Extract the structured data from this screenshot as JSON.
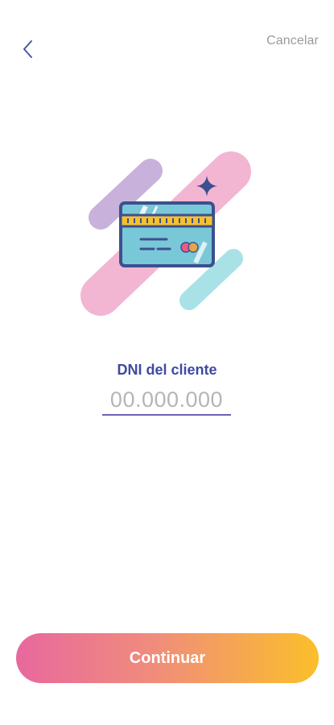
{
  "header": {
    "back_icon": "chevron-left-icon",
    "cancel_label": "Cancelar"
  },
  "illustration": {
    "icon": "credit-card-icon",
    "colors": {
      "pink": "#f2b6d2",
      "lavender": "#c8b2db",
      "teal": "#a9e2e6",
      "navy": "#3d4f8e",
      "gold": "#f6c12c",
      "card_blue": "#79c8d8",
      "mc_red": "#ea5b86",
      "mc_orange": "#f2a33c"
    }
  },
  "form": {
    "label": "DNI del cliente",
    "placeholder": "00.000.000",
    "value": ""
  },
  "actions": {
    "continue_label": "Continuar"
  },
  "colors": {
    "accent": "#3f4aa1",
    "underline": "#6b62b4",
    "gradient_start": "#e8689e",
    "gradient_end": "#fbbf2a"
  }
}
